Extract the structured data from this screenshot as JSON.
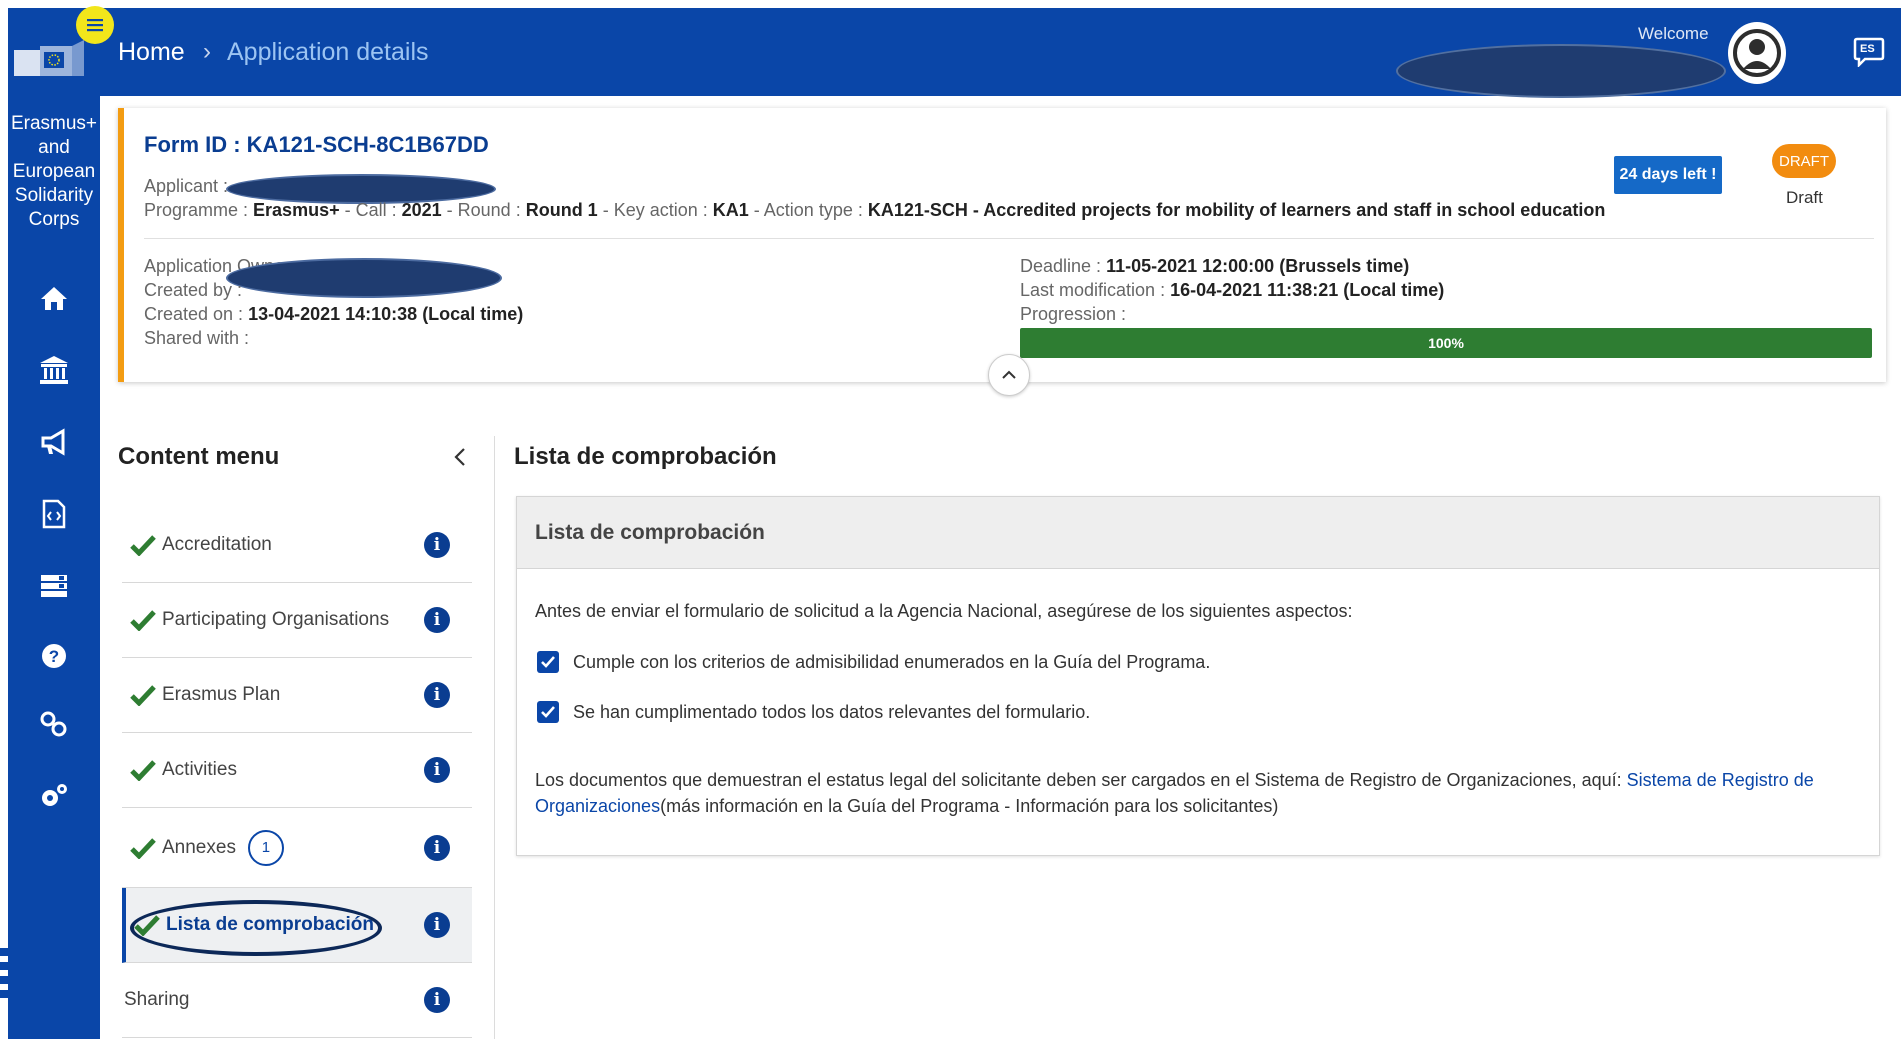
{
  "rail": {
    "title": "Erasmus+ and European Solidarity Corps",
    "title_lines": [
      "Erasmus+",
      "and",
      "European",
      "Solidarity",
      "Corps"
    ],
    "icons": [
      "home-icon",
      "institution-icon",
      "megaphone-icon",
      "code-file-icon",
      "list-icon",
      "help-icon",
      "link-icon",
      "settings-icon"
    ]
  },
  "header": {
    "home": "Home",
    "separator": "›",
    "current": "Application details",
    "welcome": "Welcome",
    "language": "ES"
  },
  "form": {
    "form_id": "Form ID : KA121-SCH-8C1B67DD",
    "applicant_label": "Applicant : ",
    "programme_label": "Programme : ",
    "programme_value": "Erasmus+",
    "call_label": " - Call : ",
    "call_value": "2021",
    "round_label": " - Round : ",
    "round_value": "Round 1",
    "key_action_label": " - Key action : ",
    "key_action_value": "KA1",
    "action_type_label": " - Action type : ",
    "action_type_value": "KA121-SCH - Accredited projects for mobility of learners and staff in school education",
    "days_left": "24 days left !",
    "status_pill": "DRAFT",
    "status_text": "Draft",
    "owner_label": "Application Owner : ",
    "created_by_label": "Created by : ",
    "created_on_label": "Created on : ",
    "created_on_value": "13-04-2021 14:10:38 (Local time)",
    "shared_with_label": "Shared with :",
    "deadline_label": "Deadline : ",
    "deadline_value": "11-05-2021 12:00:00 (Brussels time)",
    "last_mod_label": "Last modification : ",
    "last_mod_value": "16-04-2021 11:38:21 (Local time)",
    "progression_label": "Progression :",
    "progression_value": 1.0,
    "progression_text": "100%"
  },
  "content_menu": {
    "title": "Content menu",
    "items": [
      {
        "label": "Accreditation",
        "done": true
      },
      {
        "label": "Participating Organisations",
        "done": true
      },
      {
        "label": "Erasmus Plan",
        "done": true
      },
      {
        "label": "Activities",
        "done": true
      },
      {
        "label": "Annexes",
        "done": true,
        "count": "1"
      },
      {
        "label": "Lista de comprobación",
        "done": true,
        "active": true
      },
      {
        "label": "Sharing",
        "done": false
      }
    ]
  },
  "main": {
    "title": "Lista de comprobación",
    "panel_title": "Lista de comprobación",
    "intro": "Antes de enviar el formulario de solicitud a la Agencia Nacional, asegúrese de los siguientes aspectos:",
    "checks": [
      "Cumple con los criterios de admisibilidad enumerados en la Guía del Programa.",
      "Se han cumplimentado todos los datos relevantes del formulario."
    ],
    "docs_text": "Los documentos que demuestran el estatus legal del solicitante deben ser cargados en el Sistema de Registro de Organizaciones, aquí: ",
    "docs_link": "Sistema de Registro de Organizaciones",
    "docs_after": "(más información en la Guía del Programa - Información para los solicitantes)"
  },
  "colors": {
    "primary": "#0a46a8",
    "accent_orange": "#f39c12",
    "progress_green": "#2e7d32",
    "badge_blue": "#1569c7",
    "check_green": "#2e7d32"
  }
}
